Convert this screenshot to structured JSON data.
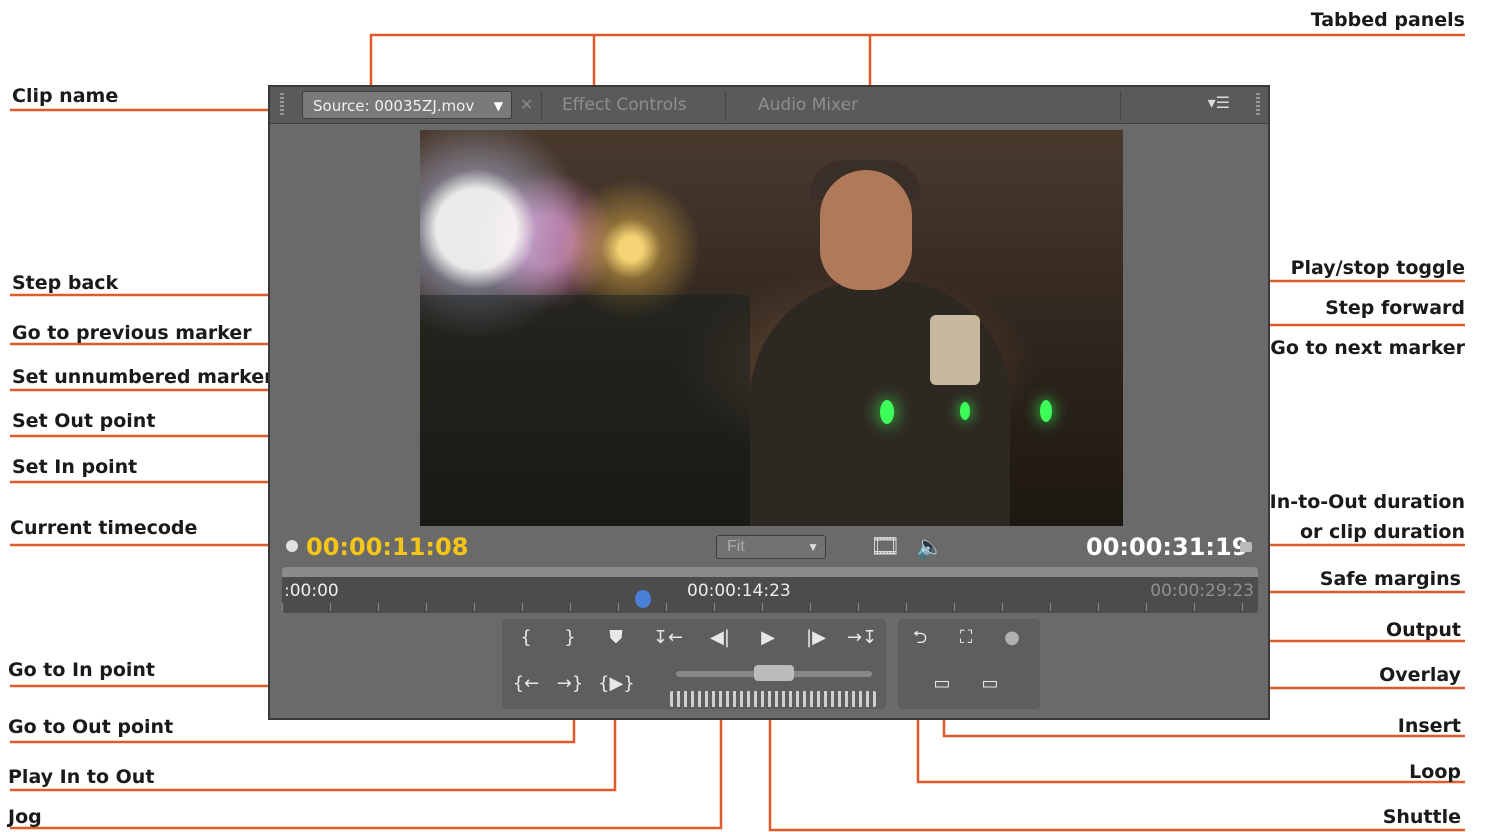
{
  "callouts": {
    "tabbed_panels": "Tabbed panels",
    "clip_name": "Clip name",
    "step_back": "Step back",
    "go_to_previous_marker": "Go to previous marker",
    "set_unnumbered_marker": "Set unnumbered marker",
    "set_out_point": "Set Out point",
    "set_in_point": "Set In point",
    "current_timecode": "Current timecode",
    "go_to_in_point": "Go to In point",
    "go_to_out_point": "Go to Out point",
    "play_in_to_out": "Play In to Out",
    "jog": "Jog",
    "play_stop_toggle": "Play/stop toggle",
    "step_forward": "Step forward",
    "go_to_next_marker": "Go to next marker",
    "in_to_out_duration_1": "In-to-Out duration",
    "in_to_out_duration_2": "or clip duration",
    "safe_margins": "Safe margins",
    "output": "Output",
    "overlay": "Overlay",
    "insert": "Insert",
    "loop": "Loop",
    "shuttle": "Shuttle"
  },
  "panel": {
    "tabs": {
      "source": "Source: 00035ZJ.mov",
      "effect_controls": "Effect Controls",
      "audio_mixer": "Audio Mixer"
    },
    "current_timecode": "00:00:11:08",
    "duration": "00:00:31:19",
    "zoom": "Fit",
    "timeline": {
      "start": ":00:00",
      "middle": "00:00:14:23",
      "end": "00:00:29:23"
    }
  },
  "colors": {
    "leader": "#e05a2b",
    "timecode": "#f5c518",
    "panel": "#6a6a6a"
  },
  "icons": {
    "set_in": "{",
    "set_out": "}",
    "marker": "⛊",
    "prev_marker": "↧←",
    "step_back": "◀|",
    "play": "▶",
    "step_forward": "|▶",
    "next_marker": "→↧",
    "go_in": "{←",
    "go_out": "→}",
    "play_in_out": "{▶}",
    "loop": "⮌",
    "safe_margins": "⛶",
    "output": "●",
    "overlay": "▭",
    "insert": "▭",
    "film": "🎞",
    "speaker": "🔈"
  }
}
